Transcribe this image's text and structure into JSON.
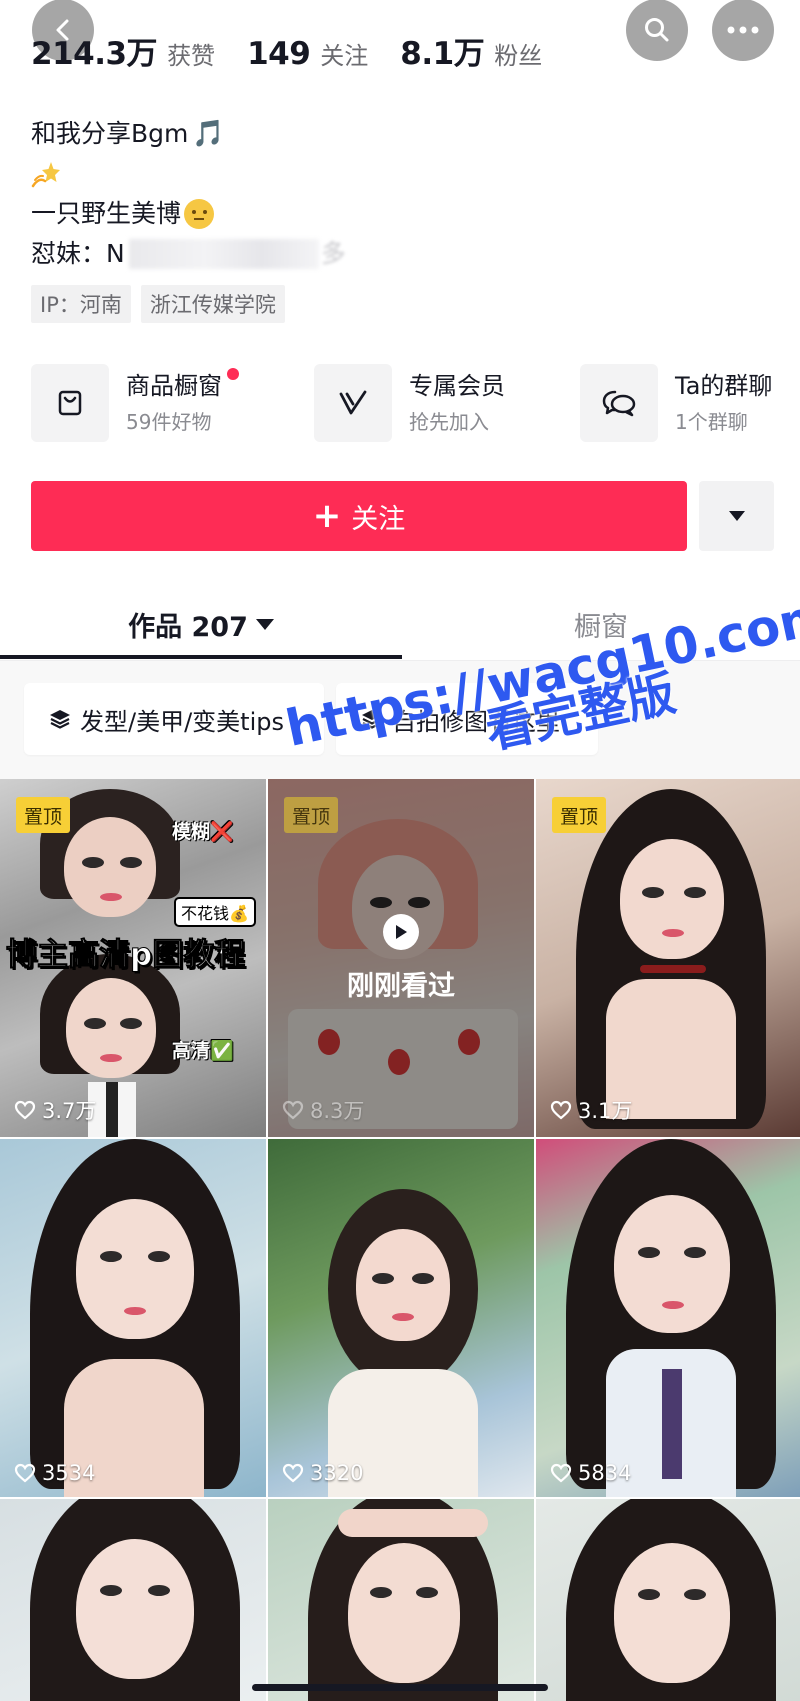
{
  "stats": [
    {
      "num": "214.3万",
      "label": "获赞"
    },
    {
      "num": "149",
      "label": "关注"
    },
    {
      "num": "8.1万",
      "label": "粉丝"
    }
  ],
  "bio": {
    "line1": "和我分享Bgm",
    "line1_emoji": "🎵",
    "line3": "一只野生美博",
    "line4_prefix": "怼妹：N",
    "line4_suffix": "多"
  },
  "tags": [
    "IP：河南",
    "浙江传媒学院"
  ],
  "features": [
    {
      "title": "商品橱窗",
      "sub": "59件好物",
      "icon": "bag-icon",
      "dot": true
    },
    {
      "title": "专属会员",
      "sub": "抢先加入",
      "icon": "v-icon",
      "dot": false
    },
    {
      "title": "Ta的群聊",
      "sub": "1个群聊",
      "icon": "chat-icon",
      "dot": false
    }
  ],
  "follow_label": "关注",
  "tabs": {
    "works": "作品 207",
    "shop": "橱窗"
  },
  "chips": [
    "发型/美甲/变美tips",
    "自拍修图看这里"
  ],
  "watermark": {
    "url": "https://wacg10.com",
    "sub": "看完整版"
  },
  "videos": [
    {
      "pin": "置顶",
      "likes": "3.7万",
      "title": "博主高清p图教程",
      "labels": [
        "模糊❌",
        "不花钱💰",
        "高清✅"
      ]
    },
    {
      "pin": "置顶",
      "likes": "8.3万",
      "watched": "刚刚看过"
    },
    {
      "pin": "置顶",
      "likes": "3.1万"
    },
    {
      "likes": "3534"
    },
    {
      "likes": "3320"
    },
    {
      "likes": "5834"
    },
    {},
    {},
    {}
  ],
  "colors": {
    "accent": "#fe2c55",
    "pin": "#f7cf36",
    "watermark": "#2e59f0"
  }
}
